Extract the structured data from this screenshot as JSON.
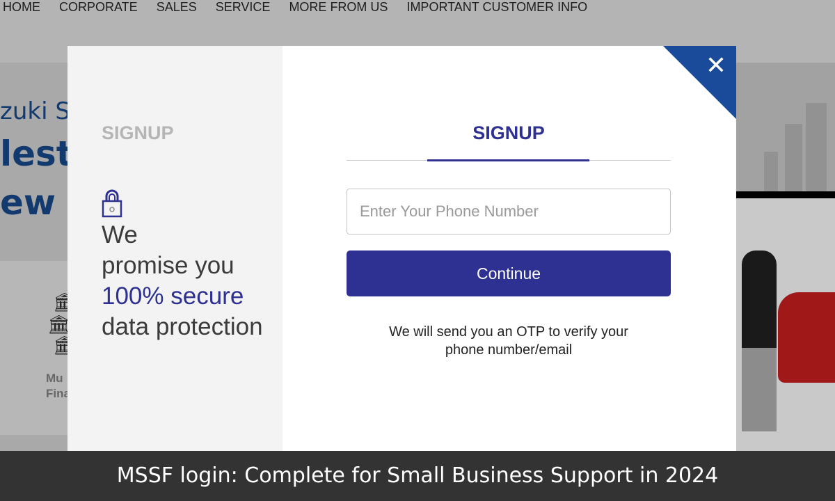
{
  "nav": {
    "items": [
      "HOME",
      "CORPORATE",
      "SALES",
      "SERVICE",
      "MORE FROM US",
      "IMPORTANT CUSTOMER INFO"
    ]
  },
  "background": {
    "line1": "zuki S",
    "line2": "lest V",
    "line3": "ew C",
    "card_text1": "Mu",
    "card_text2": "Fina"
  },
  "modal": {
    "left_title": "SIGNUP",
    "promise": {
      "line1": "We",
      "line2": "promise you",
      "highlight": "100% secure",
      "line4": "data protection"
    },
    "tab": "SIGNUP",
    "phone_placeholder": "Enter Your Phone Number",
    "phone_value": "",
    "continue_label": "Continue",
    "otp_line1": "We will send you an OTP to verify your",
    "otp_line2": "phone number/email",
    "close_icon": "close-icon"
  },
  "banner": {
    "text": "MSSF login: Complete for Small Business Support in 2024"
  },
  "colors": {
    "primary": "#2e3192",
    "close_bg": "#1a4b9b"
  }
}
